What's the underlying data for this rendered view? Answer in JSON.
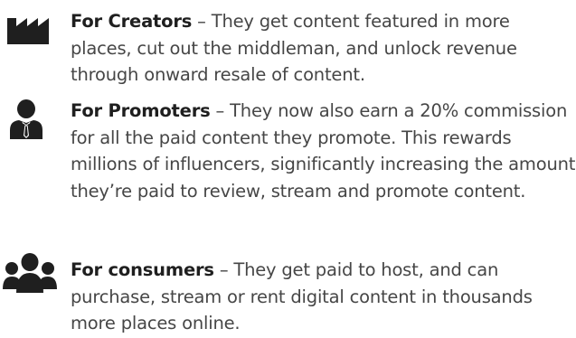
{
  "items": [
    {
      "icon": "factory-icon",
      "label": "For Creators",
      "text": " – They get content featured in more places, cut out the middleman, and unlock revenue through onward resale of content."
    },
    {
      "icon": "businessman-icon",
      "label": "For Promoters",
      "text": " – They now also earn a 20% commission for all the paid content they promote. This rewards millions of influencers, significantly increasing the amount they’re paid to review, stream and promote content."
    },
    {
      "icon": "group-icon",
      "label": "For consumers",
      "text": " – They get paid to host, and can purchase, stream or rent digital content in thousands more places online."
    }
  ],
  "colors": {
    "icon": "#1f1f1f",
    "label": "#1f1f1f",
    "text": "#464646"
  }
}
